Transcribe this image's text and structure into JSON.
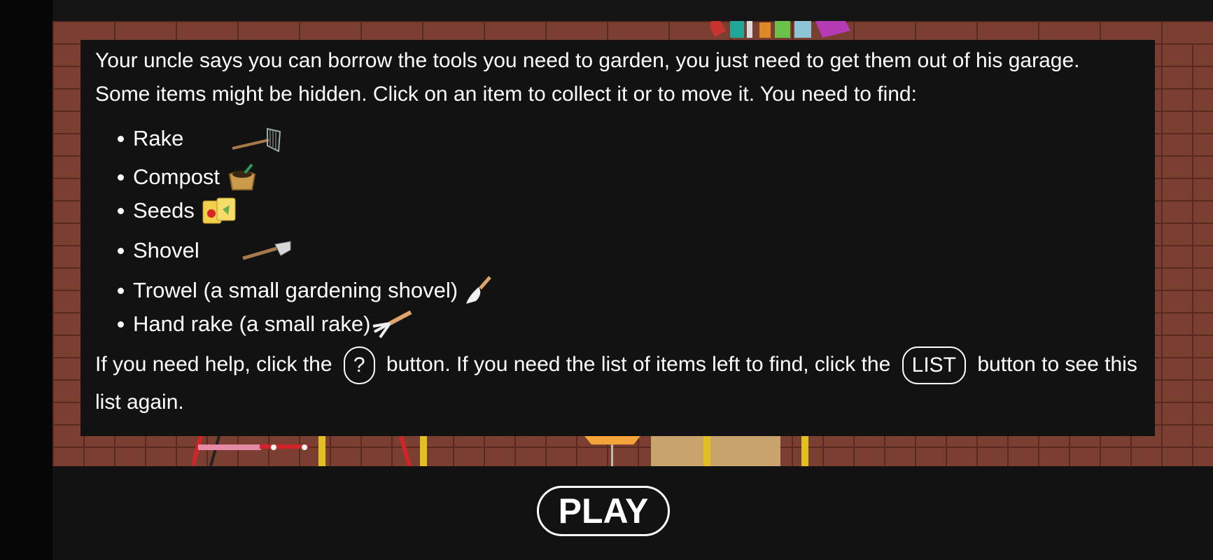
{
  "dialog": {
    "intro": "Your uncle says you can borrow the tools you need to garden, you just need to get them out of his garage. Some items might be hidden. Click on an item to collect it or to move it. You need to find:",
    "items": [
      {
        "label": "Rake",
        "icon": "rake-icon"
      },
      {
        "label": "Compost",
        "icon": "compost-bag-icon"
      },
      {
        "label": "Seeds",
        "icon": "seed-packets-icon"
      },
      {
        "label": "Shovel",
        "icon": "shovel-icon"
      },
      {
        "label": "Trowel (a small gardening shovel)",
        "icon": "trowel-icon"
      },
      {
        "label": "Hand rake (a small rake)",
        "icon": "hand-rake-icon"
      }
    ],
    "help_part1": "If you need help, click the",
    "help_button": "?",
    "help_part2": "button. If you need the list of items left to find, click the",
    "list_button": "LIST",
    "help_part3": "button to see this list again."
  },
  "play_button": "PLAY",
  "colors": {
    "brick": "#7b3f31",
    "mortar": "#5a2a20",
    "panel": "#121212"
  }
}
